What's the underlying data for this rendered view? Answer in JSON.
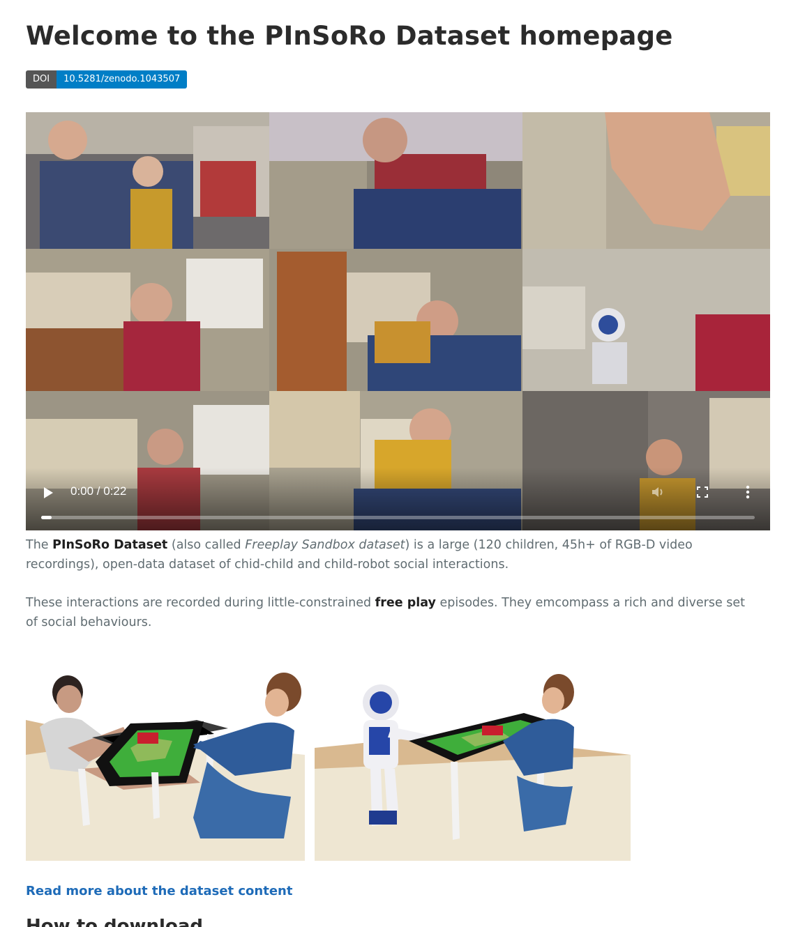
{
  "page": {
    "title": "Welcome to the PInSoRo Dataset homepage",
    "doi": {
      "key": "DOI",
      "value": "10.5281/zenodo.1043507"
    }
  },
  "video": {
    "time": "0:00 / 0:22",
    "progress": 0.015
  },
  "intro": {
    "p1_a": "The ",
    "p1_bold": "PInSoRo Dataset",
    "p1_b": " (also called ",
    "p1_italic": "Freeplay Sandbox dataset",
    "p1_c": ") is a large (120 children, 45h+ of RGB-D video recordings), open-data dataset of chid-child and child-robot social interactions.",
    "p2_a": "These interactions are recorded during little-constrained ",
    "p2_bold": "free play",
    "p2_b": " episodes. They emcompass a rich and diverse set of social behaviours."
  },
  "links": {
    "read_more": "Read more about the dataset content"
  },
  "next_heading": "How to download"
}
